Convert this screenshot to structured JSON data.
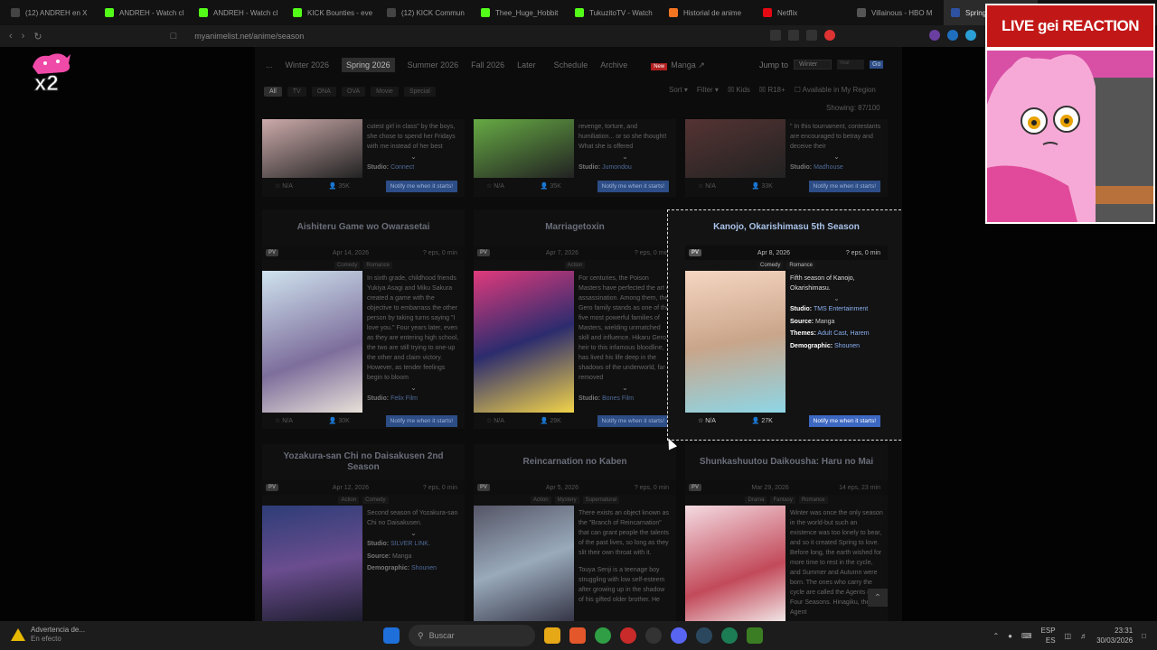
{
  "browser": {
    "tabs": [
      {
        "title": "(12) ANDREH en X",
        "icon": "x-icon",
        "color": "#444"
      },
      {
        "title": "ANDREH - Watch cl",
        "icon": "kick-icon",
        "color": "#53fc18"
      },
      {
        "title": "ANDREH - Watch cl",
        "icon": "kick-icon",
        "color": "#53fc18"
      },
      {
        "title": "KICK Bounties - eve",
        "icon": "kick-icon",
        "color": "#53fc18"
      },
      {
        "title": "(12) KICK Commun",
        "icon": "x-icon",
        "color": "#444"
      },
      {
        "title": "Thee_Huge_Hobbit",
        "icon": "kick-icon",
        "color": "#53fc18"
      },
      {
        "title": "TukuzitoTV - Watch",
        "icon": "kick-icon",
        "color": "#53fc18"
      },
      {
        "title": "Historial de anime",
        "icon": "crunchyroll-icon",
        "color": "#f47521"
      },
      {
        "title": "Netflix",
        "icon": "netflix-icon",
        "color": "#e50914"
      },
      {
        "title": "Villainous - HBO M",
        "icon": "hbo-icon",
        "color": "#555"
      },
      {
        "title": "Spring 2",
        "icon": "mal-icon",
        "color": "#2e51a2"
      }
    ],
    "url": "myanimelist.net/anime/season"
  },
  "mal": {
    "nav": {
      "ellipsis": "...",
      "seasons": [
        "Winter 2026",
        "Spring 2026",
        "Summer 2026",
        "Fall 2026"
      ],
      "later": "Later",
      "schedule": "Schedule",
      "archive": "Archive",
      "new_badge": "New",
      "manga": "Manga",
      "jump_to": "Jump to",
      "jump_season": "Winter",
      "year_placeholder": "Year",
      "go": "Go"
    },
    "types": [
      "All",
      "TV",
      "ONA",
      "OVA",
      "Movie",
      "Special"
    ],
    "filters": {
      "sort": "Sort",
      "filter": "Filter",
      "kids": "Kids",
      "r18": "R18+",
      "region": "Available in My Region"
    },
    "showing": "Showing: 87/100",
    "top_row": [
      {
        "synopsis": "cutest girl in class\" by the boys, she chose to spend her Fridays with me instead of her best",
        "studio": "Connect",
        "score": "N/A",
        "members": "35K"
      },
      {
        "synopsis": "revenge, torture, and humiliation... or so she thought! What she is offered",
        "studio": "Jumondou",
        "score": "N/A",
        "members": "35K"
      },
      {
        "synopsis": "\" In this tournament, contestants are encouraged to betray and deceive their",
        "studio": "Madhouse",
        "score": "N/A",
        "members": "33K"
      }
    ],
    "mid_row": [
      {
        "title": "Aishiteru Game wo Owarasetai",
        "date": "Apr 14, 2026",
        "eps": "? eps, 0 min",
        "genres": [
          "Comedy",
          "Romance"
        ],
        "synopsis": "In sixth grade, childhood friends Yukiya Asagi and Miku Sakura created a game with the objective to embarrass the other person by taking turns saying \"I love you.\" Four years later, even as they are entering high school, the two are still trying to one-up the other and claim victory. However, as tender feelings begin to bloom",
        "studio": "Felix Film",
        "score": "N/A",
        "members": "30K"
      },
      {
        "title": "Marriagetoxin",
        "date": "Apr 7, 2026",
        "eps": "? eps, 0 min",
        "genres": [
          "Action"
        ],
        "synopsis": "For centuries, the Poison Masters have perfected the art of assassination. Among them, the Gero family stands as one of the five most powerful families of Masters, wielding unmatched skill and influence. Hikaru Gero, heir to this infamous bloodline, has lived his life deep in the shadows of the underworld, far removed",
        "studio": "Bones Film",
        "score": "N/A",
        "members": "29K"
      },
      {
        "title": "Kanojo, Okarishimasu 5th Season",
        "date": "Apr 8, 2026",
        "eps": "? eps, 0 min",
        "genres": [
          "Comedy",
          "Romance"
        ],
        "synopsis": "Fifth season of Kanojo, Okarishimasu.",
        "studio": "TMS Entertainment",
        "source": "Manga",
        "themes": "Adult Cast, Harem",
        "demographic": "Shounen",
        "score": "N/A",
        "members": "27K"
      }
    ],
    "bottom_row": [
      {
        "title": "Yozakura-san Chi no Daisakusen 2nd Season",
        "date": "Apr 12, 2026",
        "eps": "? eps, 0 min",
        "genres": [
          "Action",
          "Comedy"
        ],
        "synopsis": "Second season of Yozakura-san Chi no Daisakusen.",
        "studio": "SILVER LINK.",
        "source": "Manga",
        "demographic": "Shounen"
      },
      {
        "title": "Reincarnation no Kaben",
        "date": "Apr 5, 2026",
        "eps": "? eps, 0 min",
        "genres": [
          "Action",
          "Mystery",
          "Supernatural"
        ],
        "synopsis": "There exists an object known as the \"Branch of Reincarnation\" that can grant people the talents of the past lives, so long as they slit their own throat with it.",
        "synopsis2": "Touya Senji is a teenage boy struggling with low self-esteem after growing up in the shadow of his gifted older brother. He"
      },
      {
        "title": "Shunkashuutou Daikousha: Haru no Mai",
        "date": "Mar 29, 2026",
        "eps": "14 eps, 23 min",
        "genres": [
          "Drama",
          "Fantasy",
          "Romance"
        ],
        "synopsis": "Winter was once the only season in the world-but such an existence was too lonely to bear, and so it created Spring to love. Before long, the earth wished for more time to rest in the cycle, and Summer and Autumn were born. The ones who carry the cycle are called the Agents of the Four Seasons. Hinagiku, the Agent"
      }
    ],
    "labels": {
      "studio": "Studio:",
      "source": "Source:",
      "themes": "Themes:",
      "demographic": "Demographic:",
      "notify": "Notify me when it starts!",
      "pv": "PV"
    }
  },
  "overlay": {
    "banner": "LIVE gei REACTION",
    "logo_text": "x2"
  },
  "taskbar": {
    "warning_title": "Advertencia de...",
    "warning_sub": "En efecto",
    "search": "Buscar",
    "lang": "ESP",
    "lang2": "ES",
    "time": "23:31",
    "date": "30/03/2026"
  },
  "colors": {
    "accent": "#2e51a2",
    "notify": "#3d68c2",
    "title_link": "#a9c3ea",
    "banner": "#c21717"
  }
}
